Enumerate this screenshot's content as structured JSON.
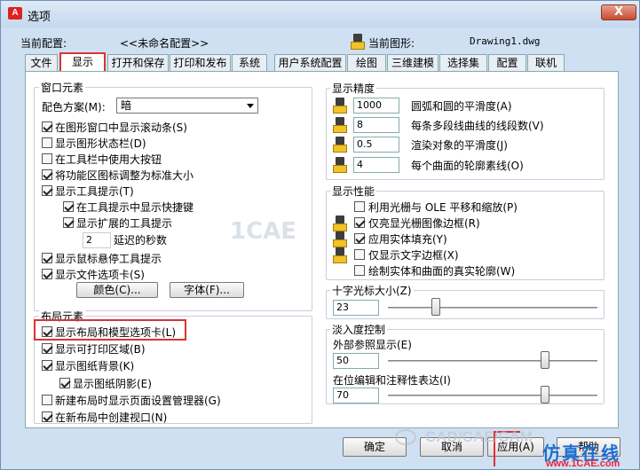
{
  "window": {
    "title": "选项",
    "close": "X"
  },
  "header": {
    "current_profile_label": "当前配置:",
    "current_profile_value": "<<未命名配置>>",
    "current_drawing_label": "当前图形:",
    "current_drawing_value": "Drawing1.dwg"
  },
  "tabs": [
    "文件",
    "显示",
    "打开和保存",
    "打印和发布",
    "系统",
    "用户系统配置",
    "绘图",
    "三维建模",
    "选择集",
    "配置",
    "联机"
  ],
  "window_elements": {
    "title": "窗口元素",
    "color_scheme_label": "配色方案(M):",
    "color_scheme_value": "暗",
    "items": [
      {
        "label": "在图形窗口中显示滚动条(S)",
        "checked": true
      },
      {
        "label": "显示图形状态栏(D)",
        "checked": false
      },
      {
        "label": "在工具栏中使用大按钮",
        "checked": false
      },
      {
        "label": "将功能区图标调整为标准大小",
        "checked": true
      },
      {
        "label": "显示工具提示(T)",
        "checked": true
      },
      {
        "label": "在工具提示中显示快捷键",
        "checked": true
      },
      {
        "label": "显示扩展的工具提示",
        "checked": true
      },
      {
        "label": "显示鼠标悬停工具提示",
        "checked": true
      },
      {
        "label": "显示文件选项卡(S)",
        "checked": true
      }
    ],
    "delay_value": "2",
    "delay_label": "延迟的秒数",
    "colors_button": "颜色(C)...",
    "fonts_button": "字体(F)..."
  },
  "layout_elements": {
    "title": "布局元素",
    "items": [
      {
        "label": "显示布局和模型选项卡(L)",
        "checked": true
      },
      {
        "label": "显示可打印区域(B)",
        "checked": true
      },
      {
        "label": "显示图纸背景(K)",
        "checked": true
      },
      {
        "label": "显示图纸阴影(E)",
        "checked": true
      },
      {
        "label": "新建布局时显示页面设置管理器(G)",
        "checked": false
      },
      {
        "label": "在新布局中创建视口(N)",
        "checked": true
      }
    ]
  },
  "display_resolution": {
    "title": "显示精度",
    "items": [
      {
        "value": "1000",
        "label": "圆弧和圆的平滑度(A)"
      },
      {
        "value": "8",
        "label": "每条多段线曲线的线段数(V)"
      },
      {
        "value": "0.5",
        "label": "渲染对象的平滑度(J)"
      },
      {
        "value": "4",
        "label": "每个曲面的轮廓素线(O)"
      }
    ]
  },
  "display_performance": {
    "title": "显示性能",
    "items": [
      {
        "label": "利用光栅与 OLE 平移和缩放(P)",
        "checked": false
      },
      {
        "label": "仅亮显光栅图像边框(R)",
        "checked": true
      },
      {
        "label": "应用实体填充(Y)",
        "checked": true
      },
      {
        "label": "仅显示文字边框(X)",
        "checked": false
      },
      {
        "label": "绘制实体和曲面的真实轮廓(W)",
        "checked": false
      }
    ]
  },
  "crosshair": {
    "title": "十字光标大小(Z)",
    "value": "23",
    "fraction": 0.23
  },
  "fade": {
    "title": "淡入度控制",
    "xref_label": "外部参照显示(E)",
    "xref_value": "50",
    "xref_fraction": 0.5,
    "inplace_label": "在位编辑和注释性表达(I)",
    "inplace_value": "70",
    "inplace_fraction": 0.7
  },
  "footer": {
    "ok": "确定",
    "cancel": "取消",
    "apply": "应用(A)",
    "help": "帮助"
  },
  "watermark": {
    "wechat": "CAD/CAE/CAM",
    "site1": "仿真在线",
    "site2": "www.1CAE.com",
    "center": "1CAE"
  }
}
